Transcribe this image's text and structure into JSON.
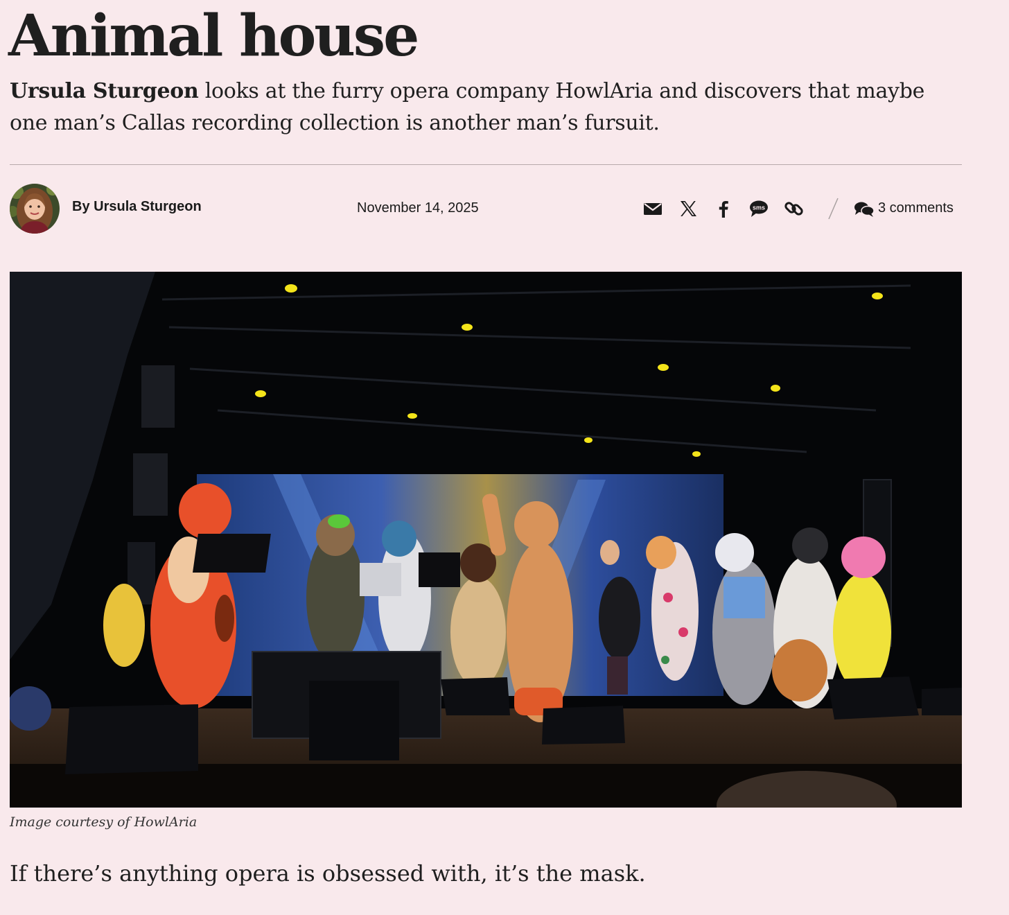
{
  "article": {
    "title": "Animal house",
    "standfirst_author": "Ursula Sturgeon",
    "standfirst_rest": " looks at the furry opera company HowlAria and discovers that maybe one man’s Callas recording collection is another man’s fursuit.",
    "byline": "By Ursula Sturgeon",
    "date": "November 14, 2025",
    "comments_label": "3 comments",
    "image_caption": "Image courtesy of HowlAria",
    "first_paragraph": "If there’s anything opera is obsessed with, it’s the mask."
  },
  "share": {
    "icons": [
      "email-icon",
      "x-icon",
      "facebook-icon",
      "sms-icon",
      "link-icon"
    ],
    "sms_label": "sms"
  },
  "colors": {
    "page_background": "#f9e9ec",
    "text": "#1f1f1f",
    "rule": "#b7a9aa"
  }
}
